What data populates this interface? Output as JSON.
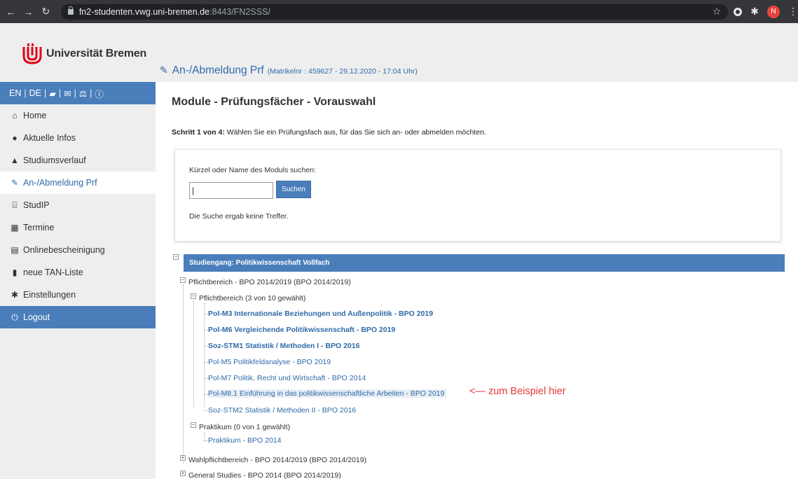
{
  "browser": {
    "url_host": "fn2-studenten.vwg.uni-bremen.de",
    "url_rest": ":8443/FN2SSS/",
    "avatar_letter": "N"
  },
  "header": {
    "logo_text": "Universität Bremen",
    "page_title": "An-/Abmeldung Prf",
    "page_meta": "(Matrikelnr : 459627 - 29.12.2020 - 17:04 Uhr)",
    "logo_color": "#e2001a"
  },
  "sidebar": {
    "lang_en": "EN",
    "lang_de": "DE",
    "items": [
      {
        "label": "Home",
        "icon": "home-icon"
      },
      {
        "label": "Aktuelle Infos",
        "icon": "comment-icon"
      },
      {
        "label": "Studiumsverlauf",
        "icon": "graduation-cap-icon"
      },
      {
        "label": "An-/Abmeldung Prf",
        "icon": "edit-icon"
      },
      {
        "label": "StudIP",
        "icon": "institution-icon"
      },
      {
        "label": "Termine",
        "icon": "calendar-icon"
      },
      {
        "label": "Onlinebescheinigung",
        "icon": "document-icon"
      },
      {
        "label": "neue TAN-Liste",
        "icon": "file-icon"
      },
      {
        "label": "Einstellungen",
        "icon": "gear-icon"
      },
      {
        "label": "Logout",
        "icon": "power-icon"
      }
    ]
  },
  "main": {
    "title": "Module - Prüfungsfächer - Vorauswahl",
    "step_bold": "Schritt 1 von 4:",
    "step_text": " Wählen Sie ein Prüfungsfach aus, für das Sie sich an- oder abmelden möchten.",
    "search": {
      "label": "Kürzel oder Name des Moduls suchen:",
      "value": "",
      "button": "Suchen",
      "result": "Die Suche ergab keine Treffer."
    },
    "tree": {
      "studiengang": "Studiengang: Politikwissenschaft Vollfach",
      "pflichtbereich_outer": "Pflichtbereich - BPO 2014/2019 (BPO 2014/2019)",
      "pflichtbereich_inner": "Pflichtbereich (3 von 10 gewählt)",
      "modules": [
        "Pol-M3 Internationale Beziehungen und Außenpolitik - BPO 2019",
        "Pol-M6 Vergleichende Politikwissenschaft - BPO 2019",
        "Soz-STM1 Statistik / Methoden I - BPO 2016",
        "Pol-M5 Politikfeldanalyse - BPO 2019",
        "Pol-M7 Politik, Recht und Wirtschaft - BPO 2014",
        "Pol-M8.1 Einführung in das politikwissenschaftliche Arbeiten - BPO 2019",
        "Soz-STM2 Statistik / Methoden II - BPO 2016"
      ],
      "praktikum_group": "Praktikum (0 von 1 gewählt)",
      "praktikum_module": "Praktikum - BPO 2014",
      "wahlpflicht": "Wahlpflichtbereich - BPO 2014/2019 (BPO 2014/2019)",
      "general": "General Studies - BPO 2014 (BPO 2014/2019)"
    },
    "annotation": "<—   zum Beispiel hier"
  }
}
